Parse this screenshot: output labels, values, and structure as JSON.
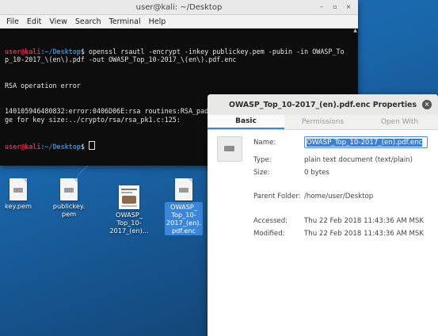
{
  "terminal": {
    "title": "user@kali: ~/Desktop",
    "controls": {
      "minimize": "–",
      "maximize": "▫",
      "close": "×"
    },
    "menu": [
      "File",
      "Edit",
      "View",
      "Search",
      "Terminal",
      "Help"
    ],
    "prompt_user": "user@kali",
    "prompt_path": ":~/Desktop",
    "prompt_symbol": "$ ",
    "command": "openssl rsautl -encrypt -inkey publickey.pem -pubin -in OWASP_Top_10-2017_\\(en\\).pdf -out OWASP_Top_10-2017_\\(en\\).pdf.enc",
    "output_1": "RSA operation error",
    "output_2": "140105946480832:error:0406D06E:rsa routines:RSA_padding_add_PKCS1_type_2:data too large for key size:../crypto/rsa/rsa_pk1.c:125:",
    "scroll_up": "▲"
  },
  "desktop": {
    "icons": [
      {
        "label": "key.pem"
      },
      {
        "label": "publickey.\npem"
      },
      {
        "label": "OWASP_\nTop_10-\n2017_(en)..."
      },
      {
        "label": "OWASP_\nTop_10-\n2017_(en).\npdf.enc"
      }
    ]
  },
  "dialog": {
    "title": "OWASP_Top_10-2017_(en).pdf.enc Properties",
    "close": "×",
    "tabs": [
      "Basic",
      "Permissions",
      "Open With"
    ],
    "name_label": "Name:",
    "name_value": "OWASP_Top_10-2017_(en).pdf.enc",
    "type_label": "Type:",
    "type_value": "plain text document (text/plain)",
    "size_label": "Size:",
    "size_value": "0 bytes",
    "parent_label": "Parent Folder:",
    "parent_value": "/home/user/Desktop",
    "accessed_label": "Accessed:",
    "accessed_value": "Thu 22 Feb 2018 11:43:36 AM MSK",
    "modified_label": "Modified:",
    "modified_value": "Thu 22 Feb 2018 11:43:36 AM MSK"
  },
  "colors": {
    "prompt_user": "#e0264a",
    "prompt_path": "#2f8cd8",
    "selection": "#3d7fd6",
    "desktop": "#1a67ac"
  }
}
